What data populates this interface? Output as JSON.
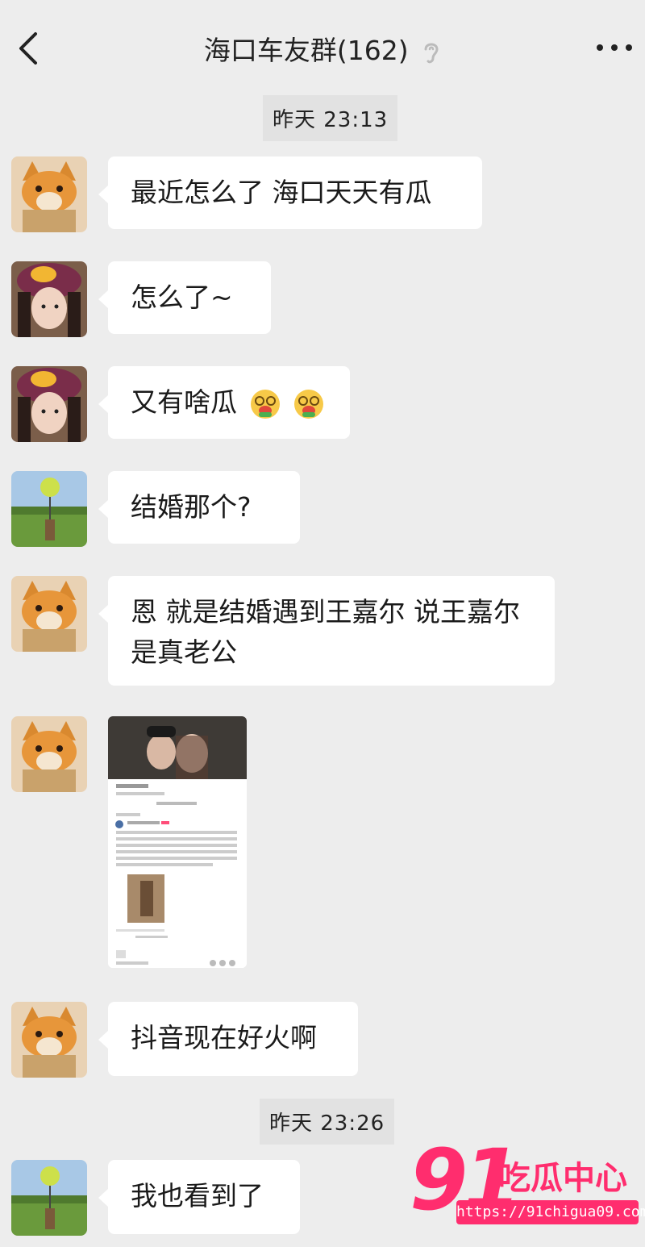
{
  "header": {
    "title": "海口车友群(162)"
  },
  "timestamps": [
    "昨天 23:13",
    "昨天 23:26"
  ],
  "messages": [
    {
      "text": "最近怎么了 海口天天有瓜"
    },
    {
      "text": "怎么了~"
    },
    {
      "text": "又有啥瓜"
    },
    {
      "text": "结婚那个?"
    },
    {
      "text": "恩 就是结婚遇到王嘉尔 说王嘉尔是真老公"
    },
    {
      "text": "抖音现在好火啊"
    },
    {
      "text": "我也看到了"
    }
  ],
  "watermark": {
    "number": "91",
    "name": "吃瓜中心",
    "url": "https://91chigua09.com"
  },
  "colors": {
    "background": "#ededed",
    "bubble": "#ffffff",
    "watermark": "#ff2d6e"
  },
  "icons": {
    "back": "chevron-left-icon",
    "mute": "ear-off-icon",
    "more": "more-dots-icon"
  }
}
